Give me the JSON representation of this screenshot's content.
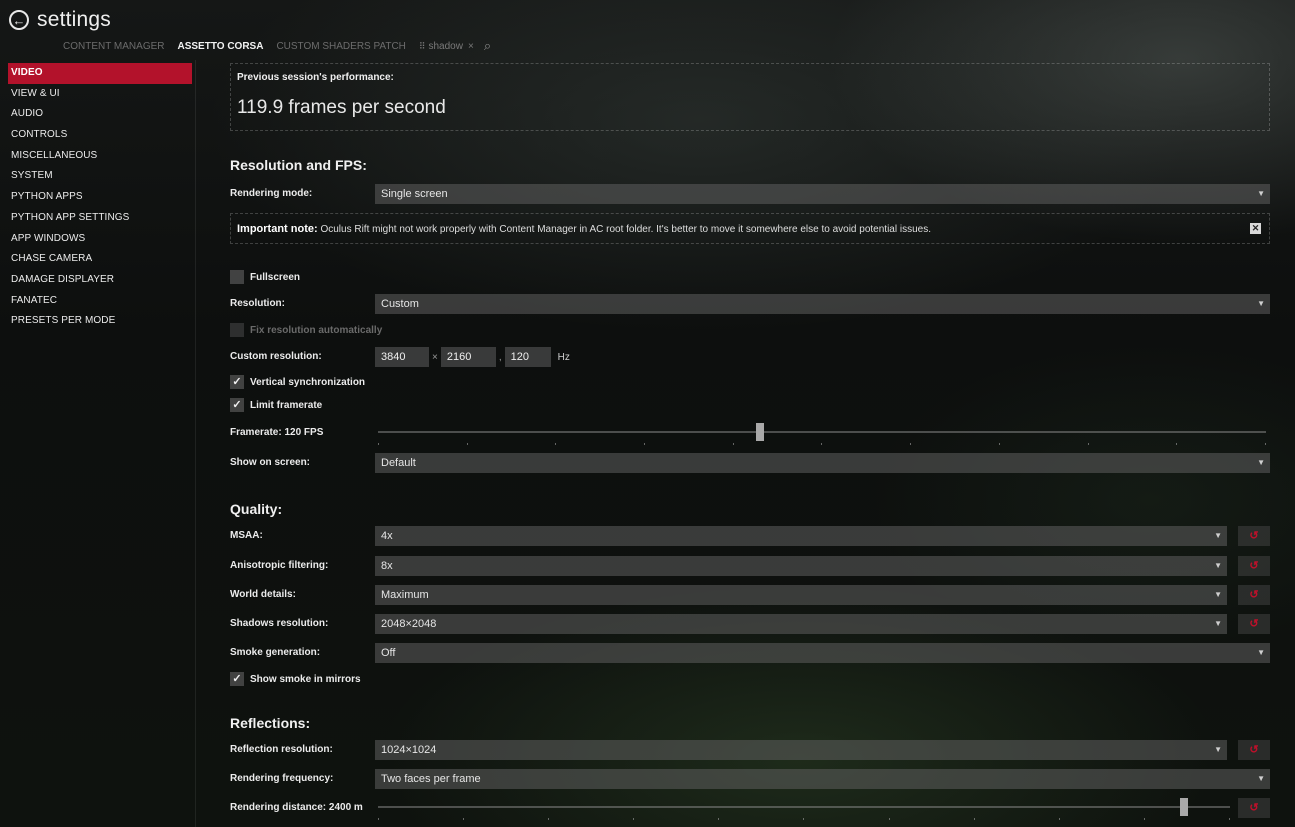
{
  "window": {
    "title": "settings"
  },
  "tabs": {
    "items": [
      "CONTENT MANAGER",
      "ASSETTO CORSA",
      "CUSTOM SHADERS PATCH"
    ],
    "active_index": 1,
    "extra_tab": {
      "label": "shadow",
      "close": "×"
    }
  },
  "sidebar": {
    "items": [
      {
        "label": "VIDEO",
        "active": true
      },
      {
        "label": "VIEW & UI"
      },
      {
        "label": "AUDIO"
      },
      {
        "label": "CONTROLS"
      },
      {
        "label": "MISCELLANEOUS"
      },
      {
        "label": "SYSTEM"
      },
      {
        "label": "PYTHON APPS"
      },
      {
        "label": "PYTHON APP SETTINGS"
      },
      {
        "label": "APP WINDOWS"
      },
      {
        "label": "CHASE CAMERA"
      },
      {
        "label": "DAMAGE DISPLAYER"
      },
      {
        "label": "FANATEC"
      },
      {
        "label": "PRESETS PER MODE"
      }
    ]
  },
  "performance": {
    "label": "Previous session's performance:",
    "value": "119.9 frames per second"
  },
  "resolution_fps": {
    "heading": "Resolution and FPS:",
    "rendering_mode": {
      "label": "Rendering mode:",
      "value": "Single screen"
    },
    "note": {
      "bold": "Important note:",
      "text": " Oculus Rift might not work properly with Content Manager in AC root folder. It's better to move it somewhere else to avoid potential issues.",
      "close": "✕"
    },
    "fullscreen": {
      "label": "Fullscreen",
      "checked": false
    },
    "resolution": {
      "label": "Resolution:",
      "value": "Custom"
    },
    "fix_resolution": {
      "label": "Fix resolution automatically",
      "checked": false,
      "disabled": true
    },
    "custom_resolution": {
      "label": "Custom resolution:",
      "width": "3840",
      "x_sep": "×",
      "height": "2160",
      "comma": ",",
      "refresh": "120",
      "unit": "Hz"
    },
    "vsync": {
      "label": "Vertical synchronization",
      "checked": true
    },
    "limit_framerate": {
      "label": "Limit framerate",
      "checked": true
    },
    "framerate": {
      "label": "Framerate: 120 FPS",
      "value_fraction": 0.43
    },
    "show_on_screen": {
      "label": "Show on screen:",
      "value": "Default"
    }
  },
  "quality": {
    "heading": "Quality:",
    "msaa": {
      "label": "MSAA:",
      "value": "4x"
    },
    "aniso": {
      "label": "Anisotropic filtering:",
      "value": "8x"
    },
    "world": {
      "label": "World details:",
      "value": "Maximum"
    },
    "shadows": {
      "label": "Shadows resolution:",
      "value": "2048×2048"
    },
    "smoke": {
      "label": "Smoke generation:",
      "value": "Off"
    },
    "smoke_mirrors": {
      "label": "Show smoke in mirrors",
      "checked": true
    }
  },
  "reflections": {
    "heading": "Reflections:",
    "resolution": {
      "label": "Reflection resolution:",
      "value": "1024×1024"
    },
    "frequency": {
      "label": "Rendering frequency:",
      "value": "Two faces per frame"
    },
    "distance": {
      "label": "Rendering distance: 2400 m",
      "value_fraction": 0.95
    }
  },
  "glyphs": {
    "check": "✓",
    "dropdown": "▼",
    "reset": "↺",
    "back": "←",
    "search": "⌕",
    "grip": "⠿"
  },
  "colors": {
    "accent": "#b3122b"
  }
}
